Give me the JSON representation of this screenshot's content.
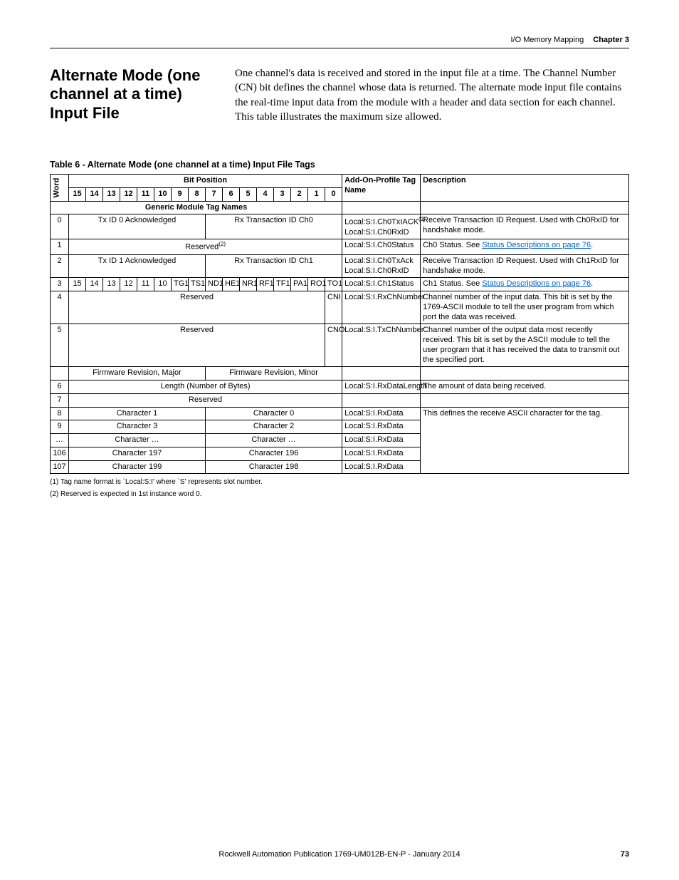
{
  "breadcrumb": {
    "section": "I/O Memory Mapping",
    "chapter": "Chapter 3"
  },
  "heading": "Alternate Mode (one channel at a time) Input File",
  "intro": "One channel's data is received and stored in the input file at a time. The Channel Number (CN) bit defines the channel whose data is returned. The alternate mode input file contains the real-time input data from the module with a header and data section for each channel. This table illustrates the maximum size allowed.",
  "table_caption": "Table 6 - Alternate Mode (one channel at a time) Input File Tags",
  "headers": {
    "word": "Word",
    "bit_position": "Bit Position",
    "addon": "Add-On-Profile Tag Name",
    "desc": "Description",
    "bits": [
      "15",
      "14",
      "13",
      "12",
      "11",
      "10",
      "9",
      "8",
      "7",
      "6",
      "5",
      "4",
      "3",
      "2",
      "1",
      "0"
    ]
  },
  "generic_row": "Generic Module Tag Names",
  "rows": {
    "r0": {
      "word": "0",
      "left": "Tx ID 0 Acknowledged",
      "right": "Rx Transaction ID Ch0",
      "tag1": "Local:S:I.Ch0TxIACK",
      "tag1_sup": "(1)",
      "tag2": "Local:S:I.Ch0RxID",
      "desc": "Receive Transaction ID Request. Used with Ch0RxID for handshake mode."
    },
    "r1": {
      "word": "1",
      "full": "Reserved",
      "full_sup": "(2)",
      "tag": "Local:S:I.Ch0Status",
      "desc_a": "Ch0 Status. See ",
      "desc_link": "Status Descriptions on page 76",
      "desc_b": "."
    },
    "r2": {
      "word": "2",
      "left": "Tx ID 1 Acknowledged",
      "right": "Rx Transaction ID Ch1",
      "tag1": "Local:S:I.Ch0TxAck",
      "tag2": "Local:S:I.Ch0RxID",
      "desc": "Receive Transaction ID Request. Used with Ch1RxID for handshake mode."
    },
    "r3": {
      "word": "3",
      "bits": [
        "15",
        "14",
        "13",
        "12",
        "11",
        "10",
        "TG1",
        "TS1",
        "ND1",
        "HE1",
        "NR1",
        "RF1",
        "TF1",
        "PA1",
        "RO1",
        "TO1"
      ],
      "tag": "Local:S:I.Ch1Status",
      "desc_a": "Ch1 Status. See ",
      "desc_link": "Status Descriptions on page 76",
      "desc_b": "."
    },
    "r4": {
      "word": "4",
      "left": "Reserved",
      "bit0": "CNI",
      "tag": "Local:S:I.RxChNumber",
      "desc": "Channel number of the input data. This bit is set by the 1769-ASCII module to tell the user program from which port the data was received."
    },
    "r5": {
      "word": "5",
      "left": "Reserved",
      "bit0": "CNO",
      "tag": "Local:S:I.TxChNumber",
      "desc": "Channel number of the output data most recently received. This bit is set by the ASCII module to tell the user program that it has received the data to transmit out the specified port."
    },
    "fw": {
      "left": "Firmware Revision, Major",
      "right": "Firmware Revision, Minor"
    },
    "r6": {
      "word": "6",
      "full": "Length (Number of Bytes)",
      "tag": "Local:S:I.RxDataLength",
      "desc": "The amount of data being received."
    },
    "r7": {
      "word": "7",
      "full": "Reserved"
    },
    "r8": {
      "word": "8",
      "left": "Character 1",
      "right": "Character 0",
      "tag": "Local:S:I.RxData",
      "desc": "This defines the receive ASCII character for the tag."
    },
    "r9": {
      "word": "9",
      "left": "Character 3",
      "right": "Character 2",
      "tag": "Local:S:I.RxData"
    },
    "rE": {
      "word": "…",
      "left": "Character …",
      "right": "Character …",
      "tag": "Local:S:I.RxData"
    },
    "r106": {
      "word": "106",
      "left": "Character 197",
      "right": "Character 196",
      "tag": "Local:S:I.RxData"
    },
    "r107": {
      "word": "107",
      "left": "Character 199",
      "right": "Character 198",
      "tag": "Local:S:I.RxData"
    }
  },
  "footnotes": {
    "f1": "(1)   Tag name format is `Local:S:I' where `S' represents slot number.",
    "f2": "(2)   Reserved is expected in 1st instance word 0."
  },
  "footer": {
    "pub": "Rockwell Automation Publication 1769-UM012B-EN-P - January 2014",
    "page": "73"
  }
}
